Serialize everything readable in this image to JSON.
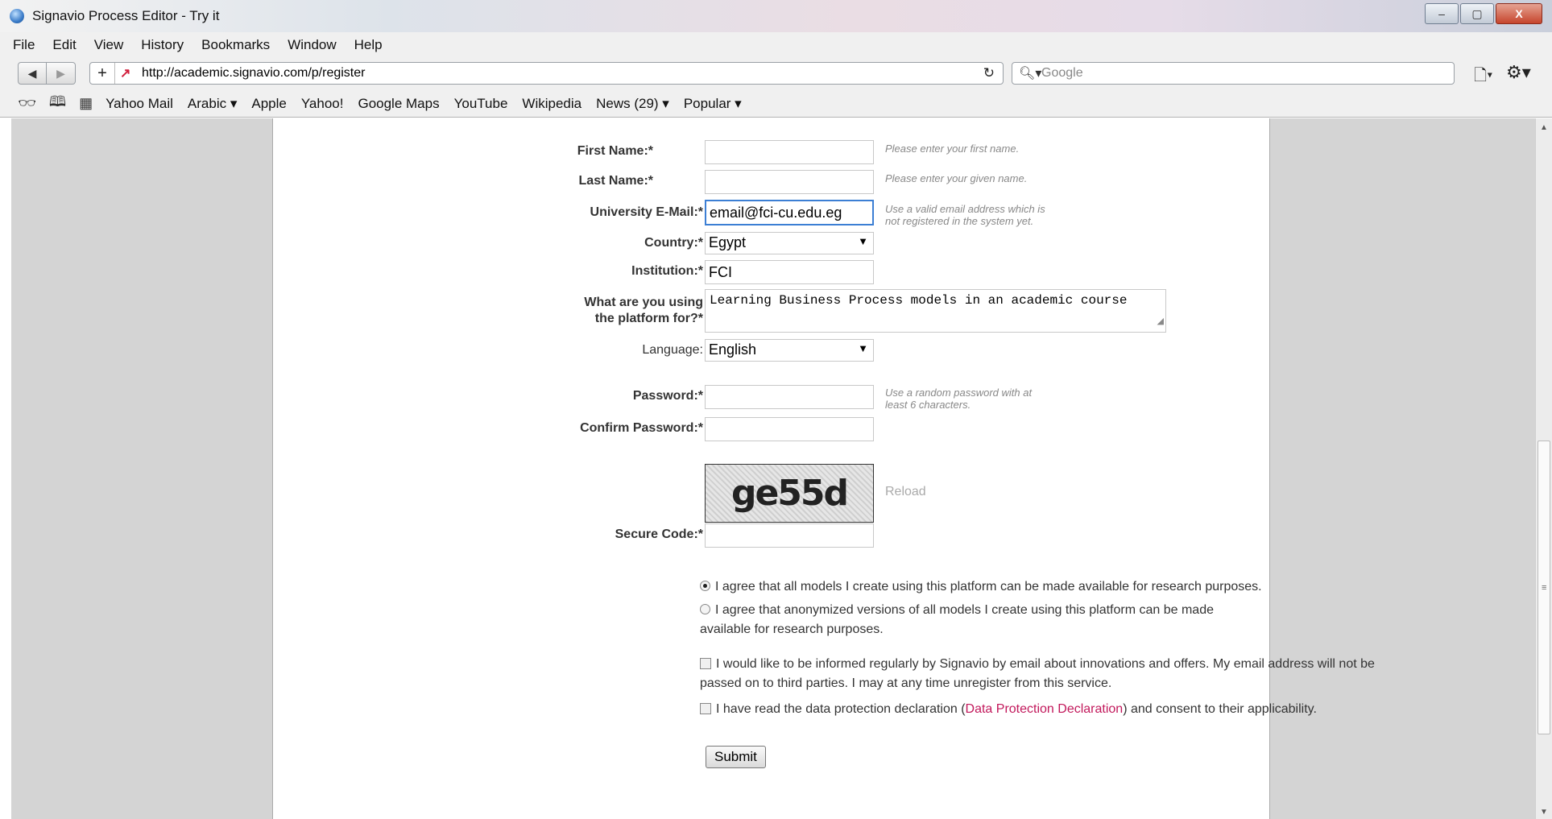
{
  "window": {
    "title": "Signavio Process Editor - Try it",
    "minimize": "–",
    "maximize": "▢",
    "close": "X"
  },
  "menu": [
    "File",
    "Edit",
    "View",
    "History",
    "Bookmarks",
    "Window",
    "Help"
  ],
  "nav": {
    "back": "◀",
    "forward": "▶",
    "add": "+",
    "url": "http://academic.signavio.com/p/register",
    "search_placeholder": "Google"
  },
  "bookmarks": [
    "Yahoo Mail",
    "Arabic ▾",
    "Apple",
    "Yahoo!",
    "Google Maps",
    "YouTube",
    "Wikipedia",
    "News (29) ▾",
    "Popular ▾"
  ],
  "form": {
    "first_name": {
      "label": "First Name:*",
      "value": "",
      "hint": "Please enter your first name."
    },
    "last_name": {
      "label": "Last Name:*",
      "value": "",
      "hint": "Please enter your given name."
    },
    "email": {
      "label": "University E-Mail:*",
      "value": "email@fci-cu.edu.eg",
      "hint": "Use a valid email address which is not registered in the system yet."
    },
    "country": {
      "label": "Country:*",
      "value": "Egypt"
    },
    "institution": {
      "label": "Institution:*",
      "value": "FCI"
    },
    "purpose": {
      "label_line1": "What are you using",
      "label_line2": "the platform for?*",
      "value": "Learning Business Process models in an academic course"
    },
    "language": {
      "label": "Language:",
      "value": "English"
    },
    "password": {
      "label": "Password:*",
      "value": "",
      "hint": "Use a random password with at least 6 characters."
    },
    "confirm_password": {
      "label": "Confirm Password:*",
      "value": ""
    },
    "captcha": {
      "text": "ge55d",
      "reload": "Reload"
    },
    "secure_code": {
      "label": "Secure Code:*",
      "value": ""
    },
    "radio_research": {
      "text": "I agree that all models I create using this platform can be made available for research purposes.",
      "selected": true
    },
    "radio_anonymized": {
      "text": "I agree that anonymized versions of all models I create using this platform can be made available for research purposes.",
      "selected": false
    },
    "newsletter": {
      "text": "I would like to be informed regularly by Signavio by email about innovations and offers. My email address will not be passed on to third parties. I may at any time unregister from this service.",
      "checked": false
    },
    "data_protection": {
      "before": "I have read the data protection declaration (",
      "link": "Data Protection Declaration",
      "after": ") and consent to their applicability.",
      "checked": false
    },
    "submit": "Submit"
  }
}
